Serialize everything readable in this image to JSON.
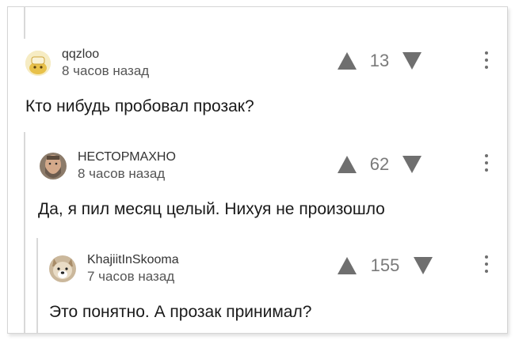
{
  "comments": [
    {
      "username": "qqzloo",
      "time": "8 часов назад",
      "score": "13",
      "text": "Кто нибудь пробовал прозак?",
      "avatar_icon": "cartoon-character-avatar"
    },
    {
      "username": "НЕСТОРМАХНО",
      "time": "8 часов назад",
      "score": "62",
      "text": "Да, я пил месяц целый. Нихуя не произошло",
      "avatar_icon": "bearded-man-avatar"
    },
    {
      "username": "KhajiitInSkooma",
      "time": "7 часов назад",
      "score": "155",
      "text": "Это понятно. А прозак принимал?",
      "avatar_icon": "dog-avatar"
    }
  ],
  "colors": {
    "text": "#1a1a1a",
    "meta": "#555555",
    "vote_icon": "#6f6f6f",
    "thread_line": "#d9d9d9"
  }
}
